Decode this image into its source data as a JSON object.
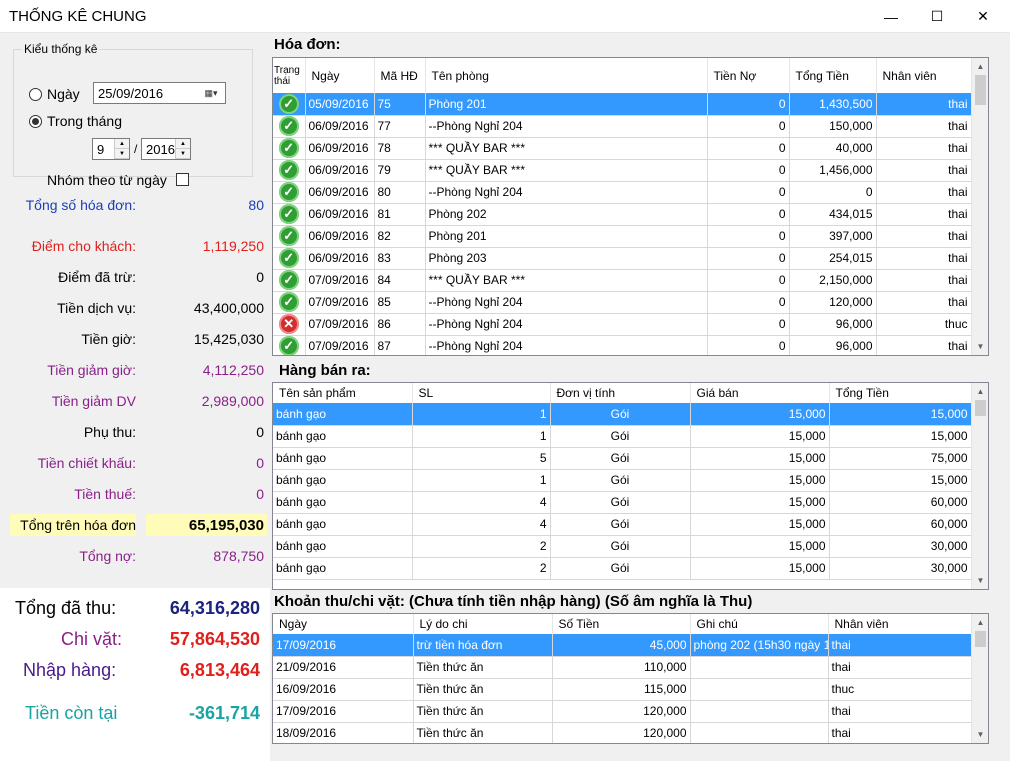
{
  "window": {
    "title": "THỐNG KÊ CHUNG",
    "minimize": "—",
    "maximize": "☐",
    "close": "✕"
  },
  "filter": {
    "group_title": "Kiểu thống kê",
    "day_label": "Ngày",
    "day_value": "25/09/2016",
    "month_label": "Trong tháng",
    "month_value": "9",
    "year_value": "2016",
    "slash": "/",
    "group_by_day_label": "Nhóm theo từ ngày"
  },
  "stats": [
    {
      "label": "Tổng số hóa đơn:",
      "value": "80",
      "color": "#1a3fb8"
    },
    {
      "label": "Điểm cho khách:",
      "value": "1,119,250",
      "color": "#e0201c"
    },
    {
      "label": "Điểm đã trừ:",
      "value": "0",
      "color": "#000000"
    },
    {
      "label": "Tiền dịch vụ:",
      "value": "43,400,000",
      "color": "#000000"
    },
    {
      "label": "Tiền giờ:",
      "value": "15,425,030",
      "color": "#000000"
    },
    {
      "label": "Tiền giảm giờ:",
      "value": "4,112,250",
      "color": "#8a1f8a"
    },
    {
      "label": "Tiền giảm DV",
      "value": "2,989,000",
      "color": "#8a1f8a"
    },
    {
      "label": "Phụ thu:",
      "value": "0",
      "color": "#000000"
    },
    {
      "label": "Tiền chiết khấu:",
      "value": "0",
      "color": "#8a1f8a"
    },
    {
      "label": "Tiền thuế:",
      "value": "0",
      "color": "#8a1f8a"
    },
    {
      "label": "Tổng trên hóa đơn",
      "value": "65,195,030",
      "color": "#000000"
    },
    {
      "label": "Tổng nợ:",
      "value": "878,750",
      "color": "#8a1f8a"
    }
  ],
  "totals": [
    {
      "label": "Tổng đã thu:",
      "value": "64,316,280",
      "label_color": "#000000",
      "value_color": "#1a237e"
    },
    {
      "label": "Chi vặt:",
      "value": "57,864,530",
      "label_color": "#8a1f8a",
      "value_color": "#e0201c"
    },
    {
      "label": "Nhập hàng:",
      "value": "6,813,464",
      "label_color": "#4a1a8a",
      "value_color": "#e0201c"
    },
    {
      "label": "Tiền còn tại",
      "value": "-361,714",
      "label_color": "#1aa3a3",
      "value_color": "#1aa3a3"
    }
  ],
  "invoices": {
    "title": "Hóa đơn:",
    "columns": [
      "Trạng thái",
      "Ngày",
      "Mã HĐ",
      "Tên phòng",
      "Tiền Nợ",
      "Tổng Tiền",
      "Nhân viên"
    ],
    "rows": [
      {
        "status": "ok",
        "date": "05/09/2016",
        "id": "75",
        "room": "Phòng 201",
        "debt": "0",
        "total": "1,430,500",
        "staff": "thai"
      },
      {
        "status": "ok",
        "date": "06/09/2016",
        "id": "77",
        "room": "--Phòng Nghỉ 204",
        "debt": "0",
        "total": "150,000",
        "staff": "thai"
      },
      {
        "status": "ok",
        "date": "06/09/2016",
        "id": "78",
        "room": "*** QUẦY BAR ***",
        "debt": "0",
        "total": "40,000",
        "staff": "thai"
      },
      {
        "status": "ok",
        "date": "06/09/2016",
        "id": "79",
        "room": "*** QUẦY BAR ***",
        "debt": "0",
        "total": "1,456,000",
        "staff": "thai"
      },
      {
        "status": "ok",
        "date": "06/09/2016",
        "id": "80",
        "room": "--Phòng Nghỉ 204",
        "debt": "0",
        "total": "0",
        "staff": "thai"
      },
      {
        "status": "ok",
        "date": "06/09/2016",
        "id": "81",
        "room": "Phòng 202",
        "debt": "0",
        "total": "434,015",
        "staff": "thai"
      },
      {
        "status": "ok",
        "date": "06/09/2016",
        "id": "82",
        "room": "Phòng 201",
        "debt": "0",
        "total": "397,000",
        "staff": "thai"
      },
      {
        "status": "ok",
        "date": "06/09/2016",
        "id": "83",
        "room": "Phòng 203",
        "debt": "0",
        "total": "254,015",
        "staff": "thai"
      },
      {
        "status": "ok",
        "date": "07/09/2016",
        "id": "84",
        "room": "*** QUẦY BAR ***",
        "debt": "0",
        "total": "2,150,000",
        "staff": "thai"
      },
      {
        "status": "ok",
        "date": "07/09/2016",
        "id": "85",
        "room": "--Phòng Nghỉ 204",
        "debt": "0",
        "total": "120,000",
        "staff": "thai"
      },
      {
        "status": "bad",
        "date": "07/09/2016",
        "id": "86",
        "room": "--Phòng Nghỉ 204",
        "debt": "0",
        "total": "96,000",
        "staff": "thuc"
      },
      {
        "status": "ok",
        "date": "07/09/2016",
        "id": "87",
        "room": "--Phòng Nghỉ 204",
        "debt": "0",
        "total": "96,000",
        "staff": "thai"
      }
    ]
  },
  "products": {
    "title": "Hàng bán ra:",
    "columns": [
      "Tên sản phẩm",
      "SL",
      "Đơn vị tính",
      "Giá bán",
      "Tổng Tiền"
    ],
    "rows": [
      {
        "name": "bánh gạo",
        "qty": "1",
        "unit": "Gói",
        "price": "15,000",
        "total": "15,000"
      },
      {
        "name": "bánh gạo",
        "qty": "1",
        "unit": "Gói",
        "price": "15,000",
        "total": "15,000"
      },
      {
        "name": "bánh gạo",
        "qty": "5",
        "unit": "Gói",
        "price": "15,000",
        "total": "75,000"
      },
      {
        "name": "bánh gạo",
        "qty": "1",
        "unit": "Gói",
        "price": "15,000",
        "total": "15,000"
      },
      {
        "name": "bánh gạo",
        "qty": "4",
        "unit": "Gói",
        "price": "15,000",
        "total": "60,000"
      },
      {
        "name": "bánh gạo",
        "qty": "4",
        "unit": "Gói",
        "price": "15,000",
        "total": "60,000"
      },
      {
        "name": "bánh gạo",
        "qty": "2",
        "unit": "Gói",
        "price": "15,000",
        "total": "30,000"
      },
      {
        "name": "bánh gạo",
        "qty": "2",
        "unit": "Gói",
        "price": "15,000",
        "total": "30,000"
      }
    ]
  },
  "expenses": {
    "title": "Khoản thu/chi vặt: (Chưa tính tiền nhập hàng) (Số âm nghĩa là Thu)",
    "columns": [
      "Ngày",
      "Lý do chi",
      "Số Tiền",
      "Ghi chú",
      "Nhân viên"
    ],
    "rows": [
      {
        "date": "17/09/2016",
        "reason": "trừ tiền hóa đơn",
        "amount": "45,000",
        "note": "phòng 202 (15h30 ngày 1...",
        "staff": "thai"
      },
      {
        "date": "21/09/2016",
        "reason": "Tiền thức ăn",
        "amount": "110,000",
        "note": "",
        "staff": "thai"
      },
      {
        "date": "16/09/2016",
        "reason": "Tiền thức ăn",
        "amount": "115,000",
        "note": "",
        "staff": "thuc"
      },
      {
        "date": "17/09/2016",
        "reason": "Tiền thức ăn",
        "amount": "120,000",
        "note": "",
        "staff": "thai"
      },
      {
        "date": "18/09/2016",
        "reason": "Tiền thức ăn",
        "amount": "120,000",
        "note": "",
        "staff": "thai"
      }
    ]
  }
}
